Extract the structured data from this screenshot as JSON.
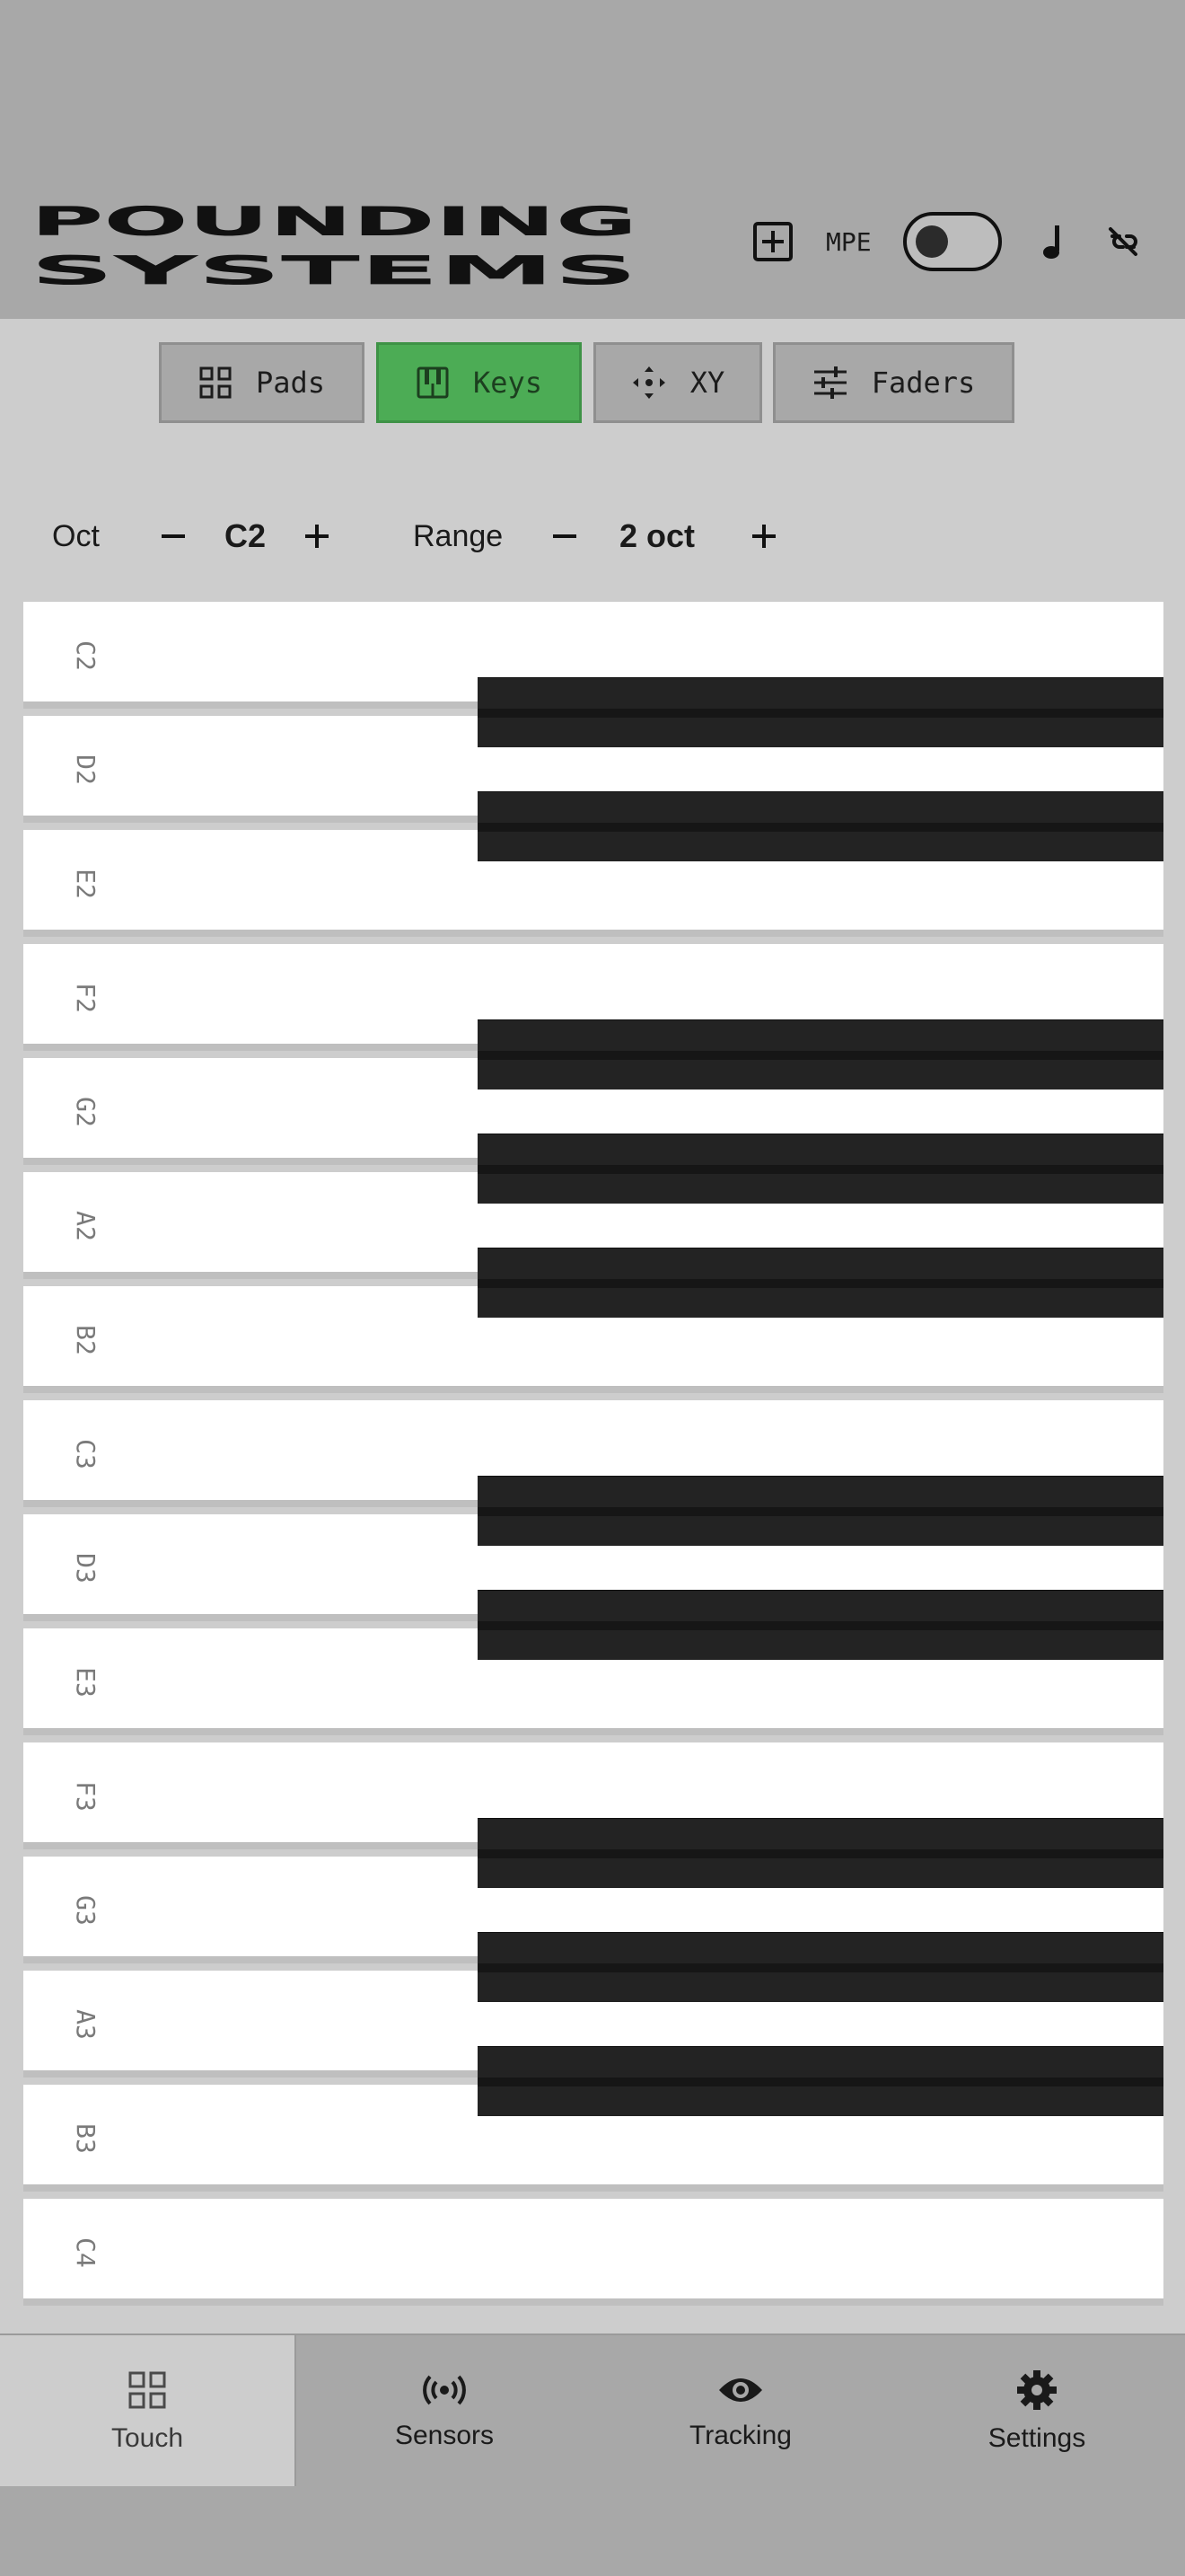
{
  "header": {
    "logo_text": "POUNDING SYSTEMS",
    "mpe_label": "MPE",
    "mpe_enabled": false,
    "icons": [
      "add-box-icon",
      "music-note-icon",
      "unlink-icon"
    ]
  },
  "modes": {
    "pads": "Pads",
    "keys": "Keys",
    "xy": "XY",
    "faders": "Faders",
    "active": "Keys",
    "active_color": "#4cac55"
  },
  "controls": {
    "oct_label": "Oct",
    "oct_value": "C2",
    "range_label": "Range",
    "range_value": "2 oct"
  },
  "keyboard": {
    "white_keys": [
      "C2",
      "D2",
      "E2",
      "F2",
      "G2",
      "A2",
      "B2",
      "C3",
      "D3",
      "E3",
      "F3",
      "G3",
      "A3",
      "B3",
      "C4"
    ],
    "black_key_after": [
      "C2",
      "D2",
      "F2",
      "G2",
      "A2",
      "C3",
      "D3",
      "F3",
      "G3",
      "A3"
    ]
  },
  "tabs": {
    "touch": "Touch",
    "sensors": "Sensors",
    "tracking": "Tracking",
    "settings": "Settings",
    "active": "Touch"
  }
}
